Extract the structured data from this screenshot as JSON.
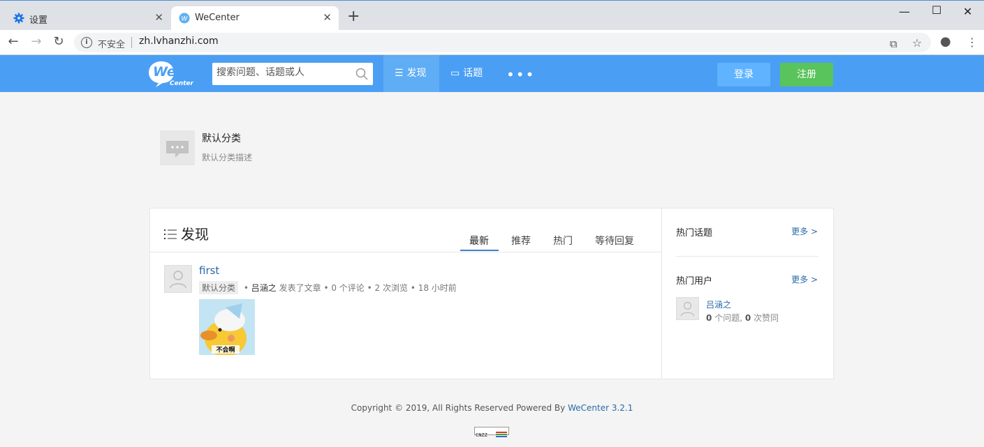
{
  "browser": {
    "tabs": [
      {
        "title": "设置",
        "icon": "gear-icon",
        "active": false
      },
      {
        "title": "WeCenter",
        "icon": "wecenter-favicon",
        "active": true
      }
    ],
    "new_tab": "+",
    "security_label": "不安全",
    "url": "zh.lvhanzhi.com"
  },
  "header": {
    "logo_text": "We",
    "logo_sub": "Center",
    "search_placeholder": "搜索问题、话题或人",
    "nav": [
      {
        "label": "发现",
        "icon": "list-icon",
        "active": true
      },
      {
        "label": "话题",
        "icon": "chat-icon",
        "active": false
      }
    ],
    "more": "•••",
    "login": "登录",
    "register": "注册",
    "colors": {
      "bar": "#4a9ff4",
      "login": "#5fb3ff",
      "register": "#59c35c"
    }
  },
  "category": {
    "title": "默认分类",
    "description": "默认分类描述"
  },
  "main": {
    "section_title": "发现",
    "tabs": [
      "最新",
      "推荐",
      "热门",
      "等待回复"
    ],
    "active_tab": "最新",
    "posts": [
      {
        "title": "first",
        "tag": "默认分类",
        "author": "吕涵之",
        "action": "发表了文章",
        "comments": "0 个评论",
        "views": "2 次浏览",
        "time": "18 小时前",
        "image_text": "不会啊"
      }
    ]
  },
  "sidebar": {
    "hot_topics": {
      "title": "热门话题",
      "more": "更多 >"
    },
    "hot_users": {
      "title": "热门用户",
      "more": "更多 >"
    },
    "users": [
      {
        "name": "吕涵之",
        "questions": "0",
        "questions_label": "个问题,",
        "likes": "0",
        "likes_label": "次赞同"
      }
    ]
  },
  "footer": {
    "text": "Copyright © 2019, All Rights Reserved Powered By",
    "link": "WeCenter 3.2.1",
    "badge": "CNZZ"
  }
}
